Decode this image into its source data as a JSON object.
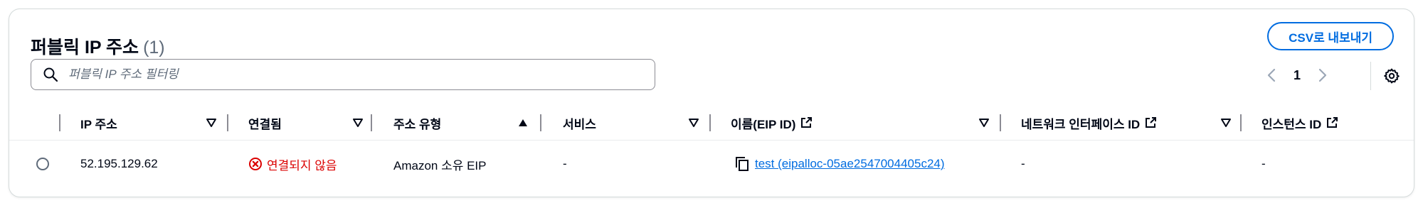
{
  "header": {
    "title": "퍼블릭 IP 주소",
    "count": "(1)",
    "export_button": "CSV로 내보내기"
  },
  "filter": {
    "placeholder": "퍼블릭 IP 주소 필터링",
    "value": ""
  },
  "pagination": {
    "current_page": "1"
  },
  "table": {
    "columns": [
      {
        "label": "IP 주소",
        "sort": "none"
      },
      {
        "label": "연결됨",
        "sort": "none"
      },
      {
        "label": "주소 유형",
        "sort": "ascending"
      },
      {
        "label": "서비스",
        "sort": "none"
      },
      {
        "label": "이름(EIP ID)",
        "sort": "none",
        "external_link": true
      },
      {
        "label": "네트워크 인터페이스 ID",
        "sort": "none",
        "external_link": true
      },
      {
        "label": "인스턴스 ID",
        "external_link": true
      }
    ],
    "rows": [
      {
        "ip": "52.195.129.62",
        "connected": "연결되지 않음",
        "address_type": "Amazon 소유 EIP",
        "service": "-",
        "name_eip": "test (eipalloc-05ae2547004405c24)",
        "network_interface": "-",
        "instance": "-"
      }
    ]
  },
  "colors": {
    "accent": "#006ce0",
    "error": "#db0000",
    "text": "#000716",
    "muted": "#5f6b7a"
  },
  "icons": {
    "search": "search-icon",
    "prev": "chevron-left-icon",
    "next": "chevron-right-icon",
    "settings": "gear-icon",
    "sort_none": "caret-down-outline-icon",
    "sort_asc": "caret-up-filled-icon",
    "external": "external-link-icon",
    "status_error": "error-x-circle-icon",
    "copy": "copy-icon"
  }
}
